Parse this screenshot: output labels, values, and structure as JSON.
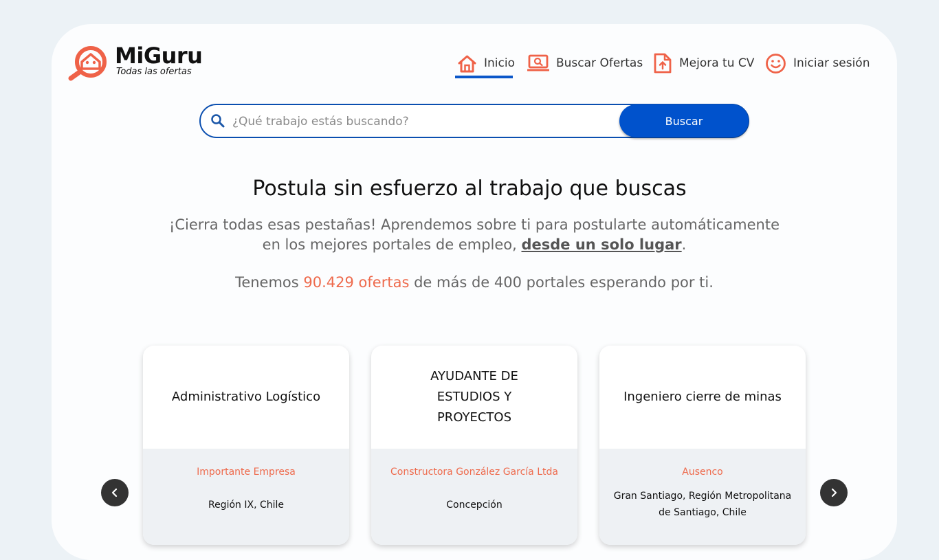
{
  "brand": {
    "name": "MiGuru",
    "tagline": "Todas las ofertas",
    "accent_color": "#ef6248",
    "primary_color": "#0052cc"
  },
  "nav": {
    "items": [
      {
        "label": "Inicio",
        "icon": "home-icon",
        "active": true
      },
      {
        "label": "Buscar Ofertas",
        "icon": "laptop-search-icon",
        "active": false
      },
      {
        "label": "Mejora tu CV",
        "icon": "document-upload-icon",
        "active": false
      },
      {
        "label": "Iniciar sesión",
        "icon": "smiley-icon",
        "active": false
      }
    ]
  },
  "search": {
    "placeholder": "¿Qué trabajo estás buscando?",
    "value": "",
    "button_label": "Buscar"
  },
  "hero": {
    "title": "Postula sin esfuerzo al trabajo que buscas",
    "subtitle_part1": "¡Cierra todas esas pestañas! Aprendemos sobre ti para postularte automáticamente en los mejores portales de empleo, ",
    "subtitle_link": "desde un solo lugar",
    "subtitle_end": ".",
    "count_prefix": "Tenemos ",
    "count_highlight": "90.429 ofertas",
    "count_suffix": " de más de 400 portales esperando por ti."
  },
  "jobs": [
    {
      "title": "Administrativo Logístico",
      "company": "Importante Empresa",
      "location": "Región IX, Chile"
    },
    {
      "title": "AYUDANTE DE ESTUDIOS Y PROYECTOS",
      "company": "Constructora González García Ltda",
      "location": "Concepción"
    },
    {
      "title": "Ingeniero cierre de minas",
      "company": "Ausenco",
      "location": "Gran Santiago, Región Metropolitana de Santiago, Chile"
    }
  ],
  "carousel": {
    "prev_icon": "chevron-left-icon",
    "next_icon": "chevron-right-icon"
  }
}
